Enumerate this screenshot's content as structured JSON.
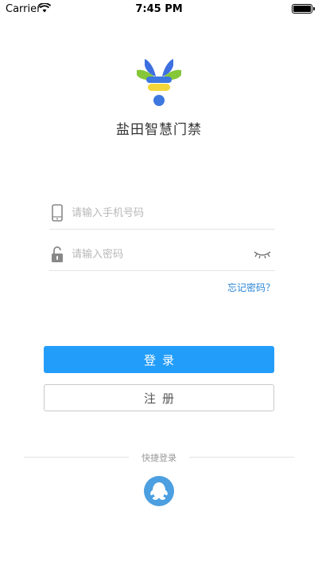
{
  "status_bar": {
    "carrier": "Carrier",
    "time": "7:45 PM",
    "wifi_icon": "wifi-icon",
    "battery_icon": "battery-icon",
    "battery_level": 1.0
  },
  "app": {
    "title": "盐田智慧门禁",
    "logo_icon": "app-logo"
  },
  "login_form": {
    "phone_placeholder": "请输入手机号码",
    "phone_value": "",
    "phone_icon": "phone-icon",
    "password_placeholder": "请输入密码",
    "password_value": "",
    "password_icon": "lock-icon",
    "toggle_visibility_icon": "eye-closed-icon",
    "forgot_password": "忘记密码？",
    "login_label": "登录",
    "register_label": "注册"
  },
  "quick_login": {
    "label": "快捷登录",
    "qq_icon": "qq-icon"
  },
  "colors": {
    "primary": "#239dfa",
    "link": "#2a85d6",
    "qq": "#4c9fe0",
    "logo_blue": "#3d78e0",
    "logo_green": "#86c73a",
    "logo_yellow": "#f2d63a"
  }
}
